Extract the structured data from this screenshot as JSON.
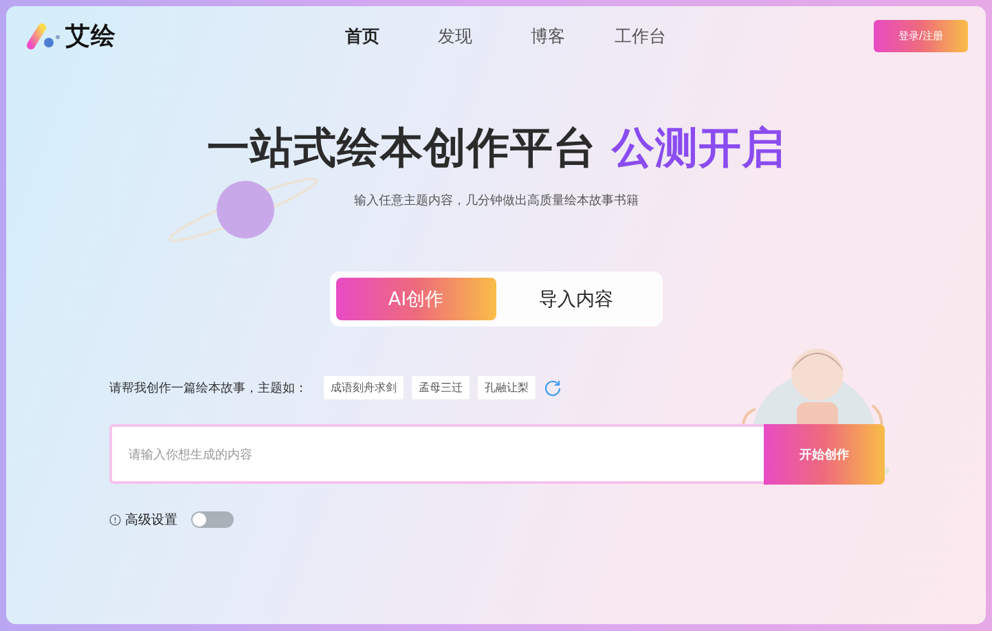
{
  "logo": {
    "text": "艾绘"
  },
  "nav": [
    {
      "label": "首页",
      "selected": true
    },
    {
      "label": "发现",
      "selected": false
    },
    {
      "label": "博客",
      "selected": false
    },
    {
      "label": "工作台",
      "selected": false
    }
  ],
  "login_button": "登录/注册",
  "hero": {
    "title": "一站式绘本创作平台",
    "highlight": "公测开启",
    "subtitle": "输入任意主题内容，几分钟做出高质量绘本故事书籍"
  },
  "mode_tabs": [
    {
      "label": "AI创作",
      "selected": true
    },
    {
      "label": "导入内容",
      "selected": false
    }
  ],
  "prompt_label": "请帮我创作一篇绘本故事，主题如：",
  "topics": [
    "成语刻舟求剑",
    "孟母三迁",
    "孔融让梨"
  ],
  "input": {
    "placeholder": "请输入你想生成的内容"
  },
  "submit_button": "开始创作",
  "advanced": {
    "label": "高级设置",
    "on": false
  }
}
